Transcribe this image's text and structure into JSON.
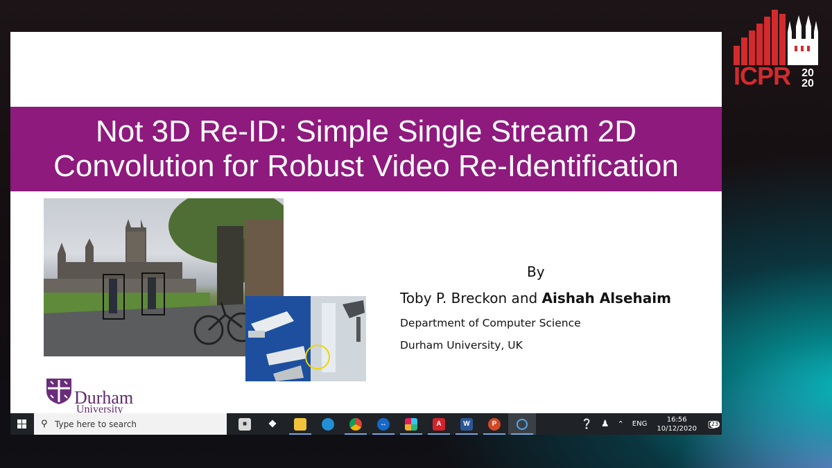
{
  "conference_logo": {
    "text": "ICPR",
    "year_top": "20",
    "year_bottom": "20",
    "color": "#d42a2e"
  },
  "slide": {
    "title_line1": "Not 3D Re-ID: Simple Single Stream 2D",
    "title_line2": "Convolution for Robust Video Re-Identification",
    "title_band_color": "#8e1a7e",
    "by": "By",
    "author1": "Toby P. Breckon",
    "author_joiner": " and ",
    "author2": "Aishah Alsehaim",
    "department": "Department of Computer Science",
    "university": "Durham University, UK",
    "logo_name": "Durham",
    "logo_sub": "University"
  },
  "taskbar": {
    "search_placeholder": "Type here to search",
    "apps": [
      {
        "name": "store",
        "icon": "store-icon"
      },
      {
        "name": "dropbox",
        "icon": "dropbox-icon"
      },
      {
        "name": "file-explorer",
        "icon": "folder-icon"
      },
      {
        "name": "edge",
        "icon": "edge-icon"
      },
      {
        "name": "chrome",
        "icon": "chrome-icon"
      },
      {
        "name": "teamviewer",
        "icon": "teamviewer-icon"
      },
      {
        "name": "slack",
        "icon": "slack-icon"
      },
      {
        "name": "acrobat",
        "icon": "acrobat-icon"
      },
      {
        "name": "word",
        "icon": "word-icon"
      },
      {
        "name": "powerpoint",
        "icon": "powerpoint-icon"
      },
      {
        "name": "cortana",
        "icon": "cortana-icon"
      }
    ],
    "language": "ENG",
    "time": "16:56",
    "date": "10/12/2020",
    "notifications": "23"
  }
}
